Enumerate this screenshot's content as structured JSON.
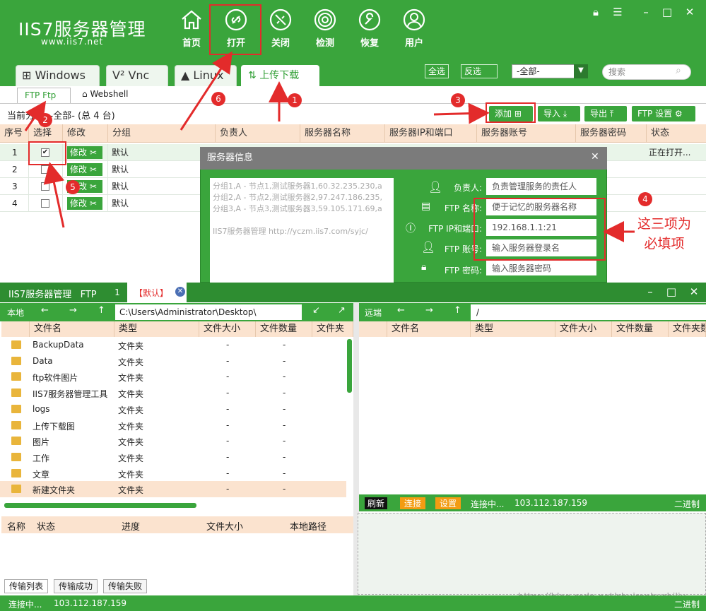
{
  "app": {
    "logo": "IIS7服务器管理",
    "url": "www.iis7.net"
  },
  "nav": [
    {
      "label": "首页",
      "icon": "home-icon"
    },
    {
      "label": "打开",
      "icon": "link-icon"
    },
    {
      "label": "关闭",
      "icon": "unlink-icon"
    },
    {
      "label": "检测",
      "icon": "radar-icon"
    },
    {
      "label": "恢复",
      "icon": "wrench-icon"
    },
    {
      "label": "用户",
      "icon": "user-icon"
    }
  ],
  "os_tabs": [
    "Windows",
    "Vnc",
    "Linux",
    "上传下载"
  ],
  "toolbar": {
    "select_all": "全选",
    "invert": "反选",
    "group_select": "-全部-",
    "search_placeholder": "搜索"
  },
  "subtabs": {
    "ftp": "FTP  Ftp",
    "webshell": "Webshell"
  },
  "current_group": "当前分组: -全部- (总 4 台)",
  "actions": {
    "add": "添加",
    "import": "导入",
    "export": "导出",
    "settings": "FTP 设置"
  },
  "table": {
    "headers": [
      "序号",
      "选择",
      "修改",
      "分组",
      "负责人",
      "服务器名称",
      "服务器IP和端口",
      "服务器账号",
      "服务器密码",
      "状态"
    ],
    "rows": [
      {
        "index": "1",
        "checked": true,
        "modify": "修改",
        "group": "默认",
        "status": "正在打开..."
      },
      {
        "index": "2",
        "checked": false,
        "modify": "修改",
        "group": "默认",
        "status": ""
      },
      {
        "index": "3",
        "checked": false,
        "modify": "修改",
        "group": "默认",
        "status": ""
      },
      {
        "index": "4",
        "checked": false,
        "modify": "修改",
        "group": "默认",
        "status": ""
      }
    ]
  },
  "dialog": {
    "title": "服务器信息",
    "example_lines": [
      "分组1,A - 节点1,测试服务器1,60.32.235.230,a",
      "分组2,A - 节点2,测试服务器2,97.247.186.235,",
      "分组3,A - 节点3,测试服务器3,59.105.171.69,a",
      "",
      "IIS7服务器管理 http://yczm.iis7.com/syjc/"
    ],
    "fields": [
      {
        "label": "负责人:",
        "value": "负责管理服务的责任人",
        "icon": "person-icon"
      },
      {
        "label": "FTP 名称:",
        "value": "便于记忆的服务器名称",
        "icon": "id-card-icon"
      },
      {
        "label": "FTP IP和端口:",
        "value": "192.168.1.1:21",
        "icon": "ip-icon"
      },
      {
        "label": "FTP 账号:",
        "value": "输入服务器登录名",
        "icon": "person-icon"
      },
      {
        "label": "FTP 密码:",
        "value": "输入服务器密码",
        "icon": "lock-icon"
      }
    ]
  },
  "annotations": {
    "badges": [
      "1",
      "2",
      "3",
      "4",
      "5",
      "6"
    ],
    "note": "这三项为\n必填项"
  },
  "ftp": {
    "title": "IIS7服务器管理   FTP",
    "tab_index": "1",
    "tab_label": "【默认】",
    "local_label": "本地",
    "local_path": "C:\\Users\\Administrator\\Desktop\\",
    "remote_label": "远端",
    "remote_path": "/",
    "columns": [
      "文件名",
      "类型",
      "文件大小",
      "文件数量",
      "文件夹"
    ],
    "remote_columns": [
      "文件名",
      "类型",
      "文件大小",
      "文件数量",
      "文件夹数"
    ],
    "files": [
      {
        "name": "BackupData",
        "type": "文件夹",
        "size": "-",
        "count": "-"
      },
      {
        "name": "Data",
        "type": "文件夹",
        "size": "-",
        "count": "-"
      },
      {
        "name": "ftp软件图片",
        "type": "文件夹",
        "size": "-",
        "count": "-"
      },
      {
        "name": "IIS7服务器管理工具",
        "type": "文件夹",
        "size": "-",
        "count": "-"
      },
      {
        "name": "logs",
        "type": "文件夹",
        "size": "-",
        "count": "-"
      },
      {
        "name": "上传下载图",
        "type": "文件夹",
        "size": "-",
        "count": "-"
      },
      {
        "name": "图片",
        "type": "文件夹",
        "size": "-",
        "count": "-"
      },
      {
        "name": "工作",
        "type": "文件夹",
        "size": "-",
        "count": "-"
      },
      {
        "name": "文章",
        "type": "文件夹",
        "size": "-",
        "count": "-"
      },
      {
        "name": "新建文件夹",
        "type": "文件夹",
        "size": "-",
        "count": "-"
      }
    ],
    "remote_status": {
      "refresh": "刷新",
      "connect": "连接",
      "settings": "设置",
      "state": "连接中...",
      "ip": "103.112.187.159",
      "mode": "二进制"
    },
    "transfer_headers": [
      "名称",
      "状态",
      "进度",
      "文件大小",
      "本地路径"
    ],
    "transfer_tabs": [
      "传输列表",
      "传输成功",
      "传输失败"
    ],
    "footer": {
      "state": "连接中...",
      "ip": "103.112.187.159",
      "mode": "二进制"
    },
    "watermark": "https://blog.csdn.net/shuirenbushiliu"
  }
}
